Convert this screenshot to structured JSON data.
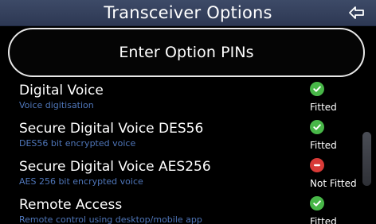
{
  "header": {
    "title": "Transceiver Options"
  },
  "actions": {
    "enter_option_pins": "Enter Option PINs"
  },
  "options": [
    {
      "title": "Digital Voice",
      "description": "Voice digitisation",
      "status": "Fitted",
      "icon": "check-circle-icon"
    },
    {
      "title": "Secure Digital Voice DES56",
      "description": "DES56 bit encrypted voice",
      "status": "Fitted",
      "icon": "check-circle-icon"
    },
    {
      "title": "Secure Digital Voice AES256",
      "description": "AES 256 bit encrypted voice",
      "status": "Not Fitted",
      "icon": "minus-circle-icon"
    },
    {
      "title": "Remote Access",
      "description": "Remote control using desktop/mobile app",
      "status": "Fitted",
      "icon": "check-circle-icon"
    }
  ],
  "icons": {
    "back": "back-arrow-icon"
  },
  "colors": {
    "background": "#000000",
    "header": "#34405b",
    "description": "#4f76b9",
    "fitted": "#48b748",
    "not_fitted": "#d83a37",
    "text": "#ffffff"
  }
}
